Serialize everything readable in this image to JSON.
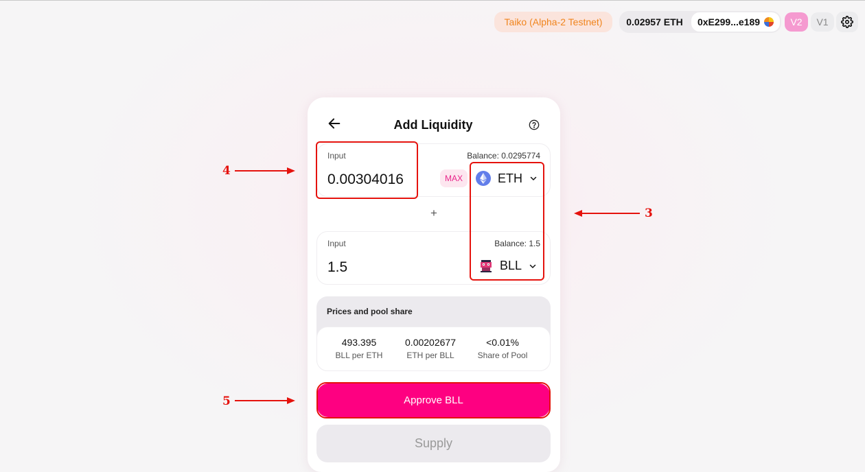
{
  "header": {
    "network": "Taiko (Alpha-2 Testnet)",
    "eth_balance": "0.02957 ETH",
    "address": "0xE299...e189",
    "versions": [
      "V2",
      "V1"
    ],
    "active_version": "V2",
    "settings_icon": "gear-icon"
  },
  "card": {
    "title": "Add Liquidity",
    "back_icon": "arrow-left-icon",
    "help_icon": "question-circle-icon",
    "input_a": {
      "label": "Input",
      "balance": "Balance: 0.0295774",
      "amount": "0.00304016",
      "max_label": "MAX",
      "token": "ETH",
      "token_icon": "ethereum-icon"
    },
    "plus": "+",
    "input_b": {
      "label": "Input",
      "balance": "Balance: 1.5",
      "amount": "1.5",
      "token": "BLL",
      "token_icon": "bll-token-icon"
    },
    "prices": {
      "title": "Prices and pool share",
      "stats": [
        {
          "value": "493.395",
          "label": "BLL per ETH"
        },
        {
          "value": "0.00202677",
          "label": "ETH per BLL"
        },
        {
          "value": "<0.01%",
          "label": "Share of Pool"
        }
      ]
    },
    "approve_label": "Approve BLL",
    "supply_label": "Supply"
  },
  "annotations": {
    "color": "#e5120d",
    "markers": [
      "4",
      "3",
      "5"
    ]
  },
  "colors": {
    "accent": "#fe0081",
    "network": "#f0841c",
    "active_version": "#f59ad0"
  }
}
